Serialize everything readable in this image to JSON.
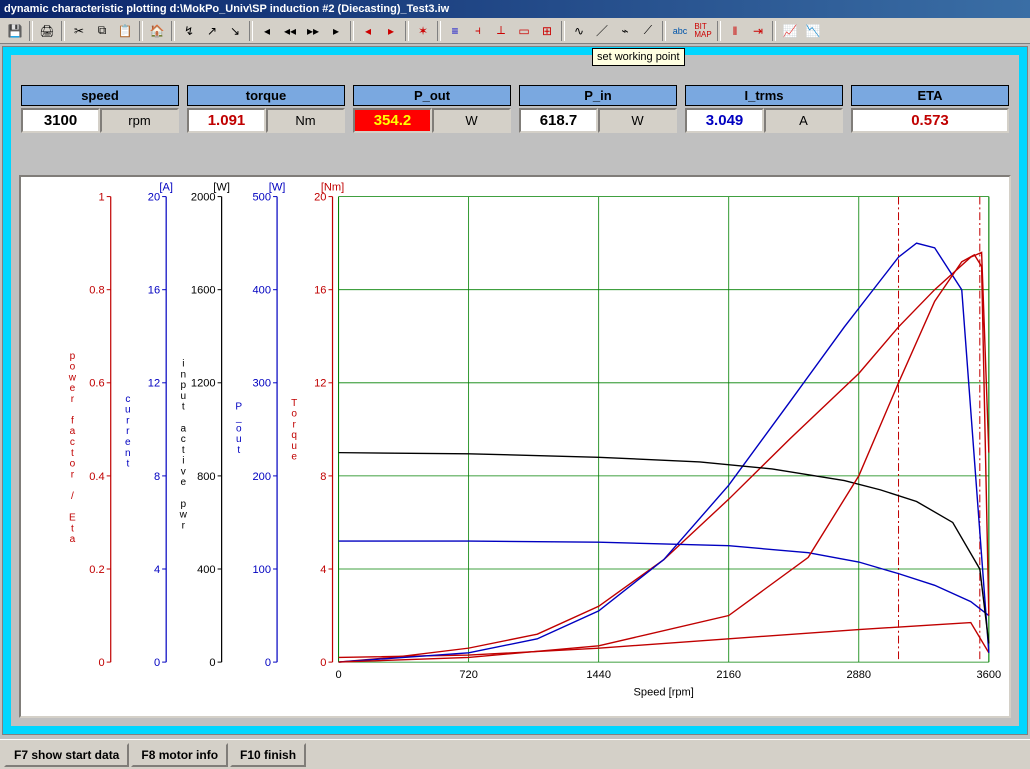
{
  "window": {
    "title": "dynamic characteristic plotting  d:\\MokPo_Univ\\SP induction #2 (Diecasting)_Test3.iw"
  },
  "tooltip": "set working point",
  "readouts": [
    {
      "key": "speed",
      "label": "speed",
      "value": "3100",
      "unit": "rpm",
      "val_class": "val-black",
      "highlight": false
    },
    {
      "key": "torque",
      "label": "torque",
      "value": "1.091",
      "unit": "Nm",
      "val_class": "val-red",
      "highlight": false
    },
    {
      "key": "pout",
      "label": "P_out",
      "value": "354.2",
      "unit": "W",
      "val_class": "",
      "highlight": true
    },
    {
      "key": "pin",
      "label": "P_in",
      "value": "618.7",
      "unit": "W",
      "val_class": "val-black",
      "highlight": false
    },
    {
      "key": "itrms",
      "label": "I_trms",
      "value": "3.049",
      "unit": "A",
      "val_class": "val-blue",
      "highlight": false
    },
    {
      "key": "eta",
      "label": "ETA",
      "value": "0.573",
      "unit": "",
      "val_class": "val-red",
      "highlight": false
    }
  ],
  "status": {
    "f7": "F7 show start data",
    "f8": "F8 motor info",
    "f10": "F10 finish"
  },
  "chart_data": {
    "type": "line",
    "xlabel": "Speed [rpm]",
    "x_ticks": [
      0,
      720,
      1440,
      2160,
      2880,
      3600
    ],
    "xlim": [
      0,
      3600
    ],
    "vertical_markers": [
      3100,
      3550
    ],
    "axes": [
      {
        "name": "power factor / Eta",
        "unit": "",
        "color": "#c00000",
        "ticks": [
          0,
          0.2,
          0.4,
          0.6,
          0.8,
          1
        ],
        "lim": [
          0,
          1
        ]
      },
      {
        "name": "current",
        "unit": "[A]",
        "color": "#0000c0",
        "ticks": [
          0,
          4,
          8,
          12,
          16,
          20
        ],
        "lim": [
          0,
          20
        ]
      },
      {
        "name": "input active pwr",
        "unit": "[W]",
        "color": "#000000",
        "ticks": [
          0,
          400,
          800,
          1200,
          1600,
          2000
        ],
        "lim": [
          0,
          2000
        ]
      },
      {
        "name": "P_out",
        "unit": "[W]",
        "color": "#0000c0",
        "ticks": [
          0,
          100,
          200,
          300,
          400,
          500
        ],
        "lim": [
          0,
          500
        ]
      },
      {
        "name": "Torque",
        "unit": "[Nm]",
        "color": "#c00000",
        "ticks": [
          0,
          4,
          8,
          12,
          16,
          20
        ],
        "lim": [
          0,
          20
        ]
      }
    ],
    "series": [
      {
        "name": "eta",
        "axis": 0,
        "color": "#c00000",
        "data": [
          [
            0,
            0
          ],
          [
            300,
            0.01
          ],
          [
            720,
            0.03
          ],
          [
            1100,
            0.06
          ],
          [
            1440,
            0.12
          ],
          [
            1800,
            0.22
          ],
          [
            2160,
            0.35
          ],
          [
            2500,
            0.48
          ],
          [
            2880,
            0.62
          ],
          [
            3100,
            0.72
          ],
          [
            3300,
            0.8
          ],
          [
            3500,
            0.87
          ],
          [
            3560,
            0.88
          ],
          [
            3600,
            0.45
          ]
        ]
      },
      {
        "name": "power_factor",
        "axis": 0,
        "color": "#c00000",
        "data": [
          [
            0,
            0.01
          ],
          [
            720,
            0.015
          ],
          [
            1440,
            0.03
          ],
          [
            2160,
            0.05
          ],
          [
            2880,
            0.07
          ],
          [
            3300,
            0.08
          ],
          [
            3500,
            0.085
          ],
          [
            3600,
            0.02
          ]
        ]
      },
      {
        "name": "current",
        "axis": 1,
        "color": "#0000c0",
        "data": [
          [
            0,
            5.2
          ],
          [
            720,
            5.2
          ],
          [
            1440,
            5.15
          ],
          [
            2160,
            5.0
          ],
          [
            2600,
            4.7
          ],
          [
            2880,
            4.3
          ],
          [
            3100,
            3.8
          ],
          [
            3300,
            3.3
          ],
          [
            3500,
            2.6
          ],
          [
            3600,
            2.0
          ]
        ]
      },
      {
        "name": "P_out",
        "axis": 3,
        "color": "#0000c0",
        "data": [
          [
            0,
            0
          ],
          [
            720,
            10
          ],
          [
            1100,
            25
          ],
          [
            1440,
            55
          ],
          [
            1800,
            110
          ],
          [
            2160,
            190
          ],
          [
            2500,
            280
          ],
          [
            2800,
            360
          ],
          [
            3000,
            410
          ],
          [
            3100,
            435
          ],
          [
            3200,
            450
          ],
          [
            3300,
            445
          ],
          [
            3450,
            400
          ],
          [
            3600,
            10
          ]
        ]
      },
      {
        "name": "input_pwr",
        "axis": 2,
        "color": "#000000",
        "data": [
          [
            0,
            900
          ],
          [
            720,
            895
          ],
          [
            1440,
            880
          ],
          [
            2000,
            860
          ],
          [
            2400,
            830
          ],
          [
            2800,
            780
          ],
          [
            3000,
            740
          ],
          [
            3200,
            690
          ],
          [
            3400,
            600
          ],
          [
            3550,
            400
          ],
          [
            3600,
            80
          ]
        ]
      },
      {
        "name": "torque",
        "axis": 4,
        "color": "#c00000",
        "data": [
          [
            0,
            0
          ],
          [
            720,
            0.2
          ],
          [
            1440,
            0.7
          ],
          [
            2160,
            2.0
          ],
          [
            2600,
            4.5
          ],
          [
            2880,
            8.0
          ],
          [
            3100,
            12.0
          ],
          [
            3300,
            15.5
          ],
          [
            3450,
            17.2
          ],
          [
            3520,
            17.5
          ],
          [
            3560,
            17.0
          ],
          [
            3600,
            2.0
          ]
        ]
      }
    ]
  }
}
